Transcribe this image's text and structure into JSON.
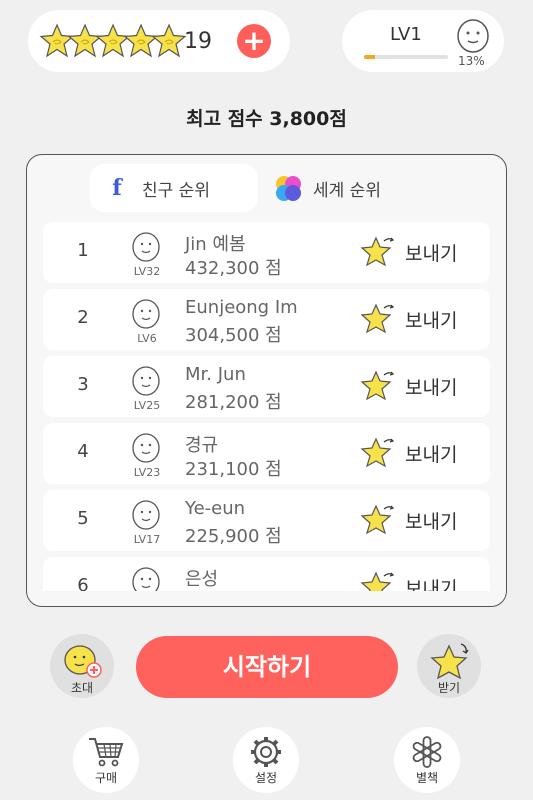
{
  "top_bar": {
    "stars_count": 5,
    "hearts_value": "19",
    "plus_label": "+",
    "level_label": "LV1",
    "level_progress_pct": 13,
    "level_pct_label": "13%"
  },
  "best_score": "최고 점수 3,800점",
  "tabs": [
    {
      "label": "친구 순위",
      "active": true,
      "icon": "facebook-icon"
    },
    {
      "label": "세계 순위",
      "active": false,
      "icon": "game-center-icon"
    }
  ],
  "rankings": [
    {
      "rank": "1",
      "level": "LV32",
      "name": "Jin 예봄",
      "score": "432,300 점",
      "action": "보내기"
    },
    {
      "rank": "2",
      "level": "LV6",
      "name": "Eunjeong Im",
      "score": "304,500 점",
      "action": "보내기"
    },
    {
      "rank": "3",
      "level": "LV25",
      "name": "Mr. Jun",
      "score": "281,200 점",
      "action": "보내기"
    },
    {
      "rank": "4",
      "level": "LV23",
      "name": "경규",
      "score": "231,100 점",
      "action": "보내기"
    },
    {
      "rank": "5",
      "level": "LV17",
      "name": "Ye-eun",
      "score": "225,900 점",
      "action": "보내기"
    },
    {
      "rank": "6",
      "level": "",
      "name": "은성",
      "score": "",
      "action": "보내기"
    }
  ],
  "actions": {
    "invite_label": "초대",
    "start_label": "시작하기",
    "receive_label": "받기"
  },
  "bottom_nav": {
    "shop_label": "구매",
    "settings_label": "설정",
    "extra_label": "별책"
  },
  "colors": {
    "accent_red": "#ff5f5a",
    "star_yellow": "#f7e24b",
    "progress_orange": "#f5a623"
  }
}
